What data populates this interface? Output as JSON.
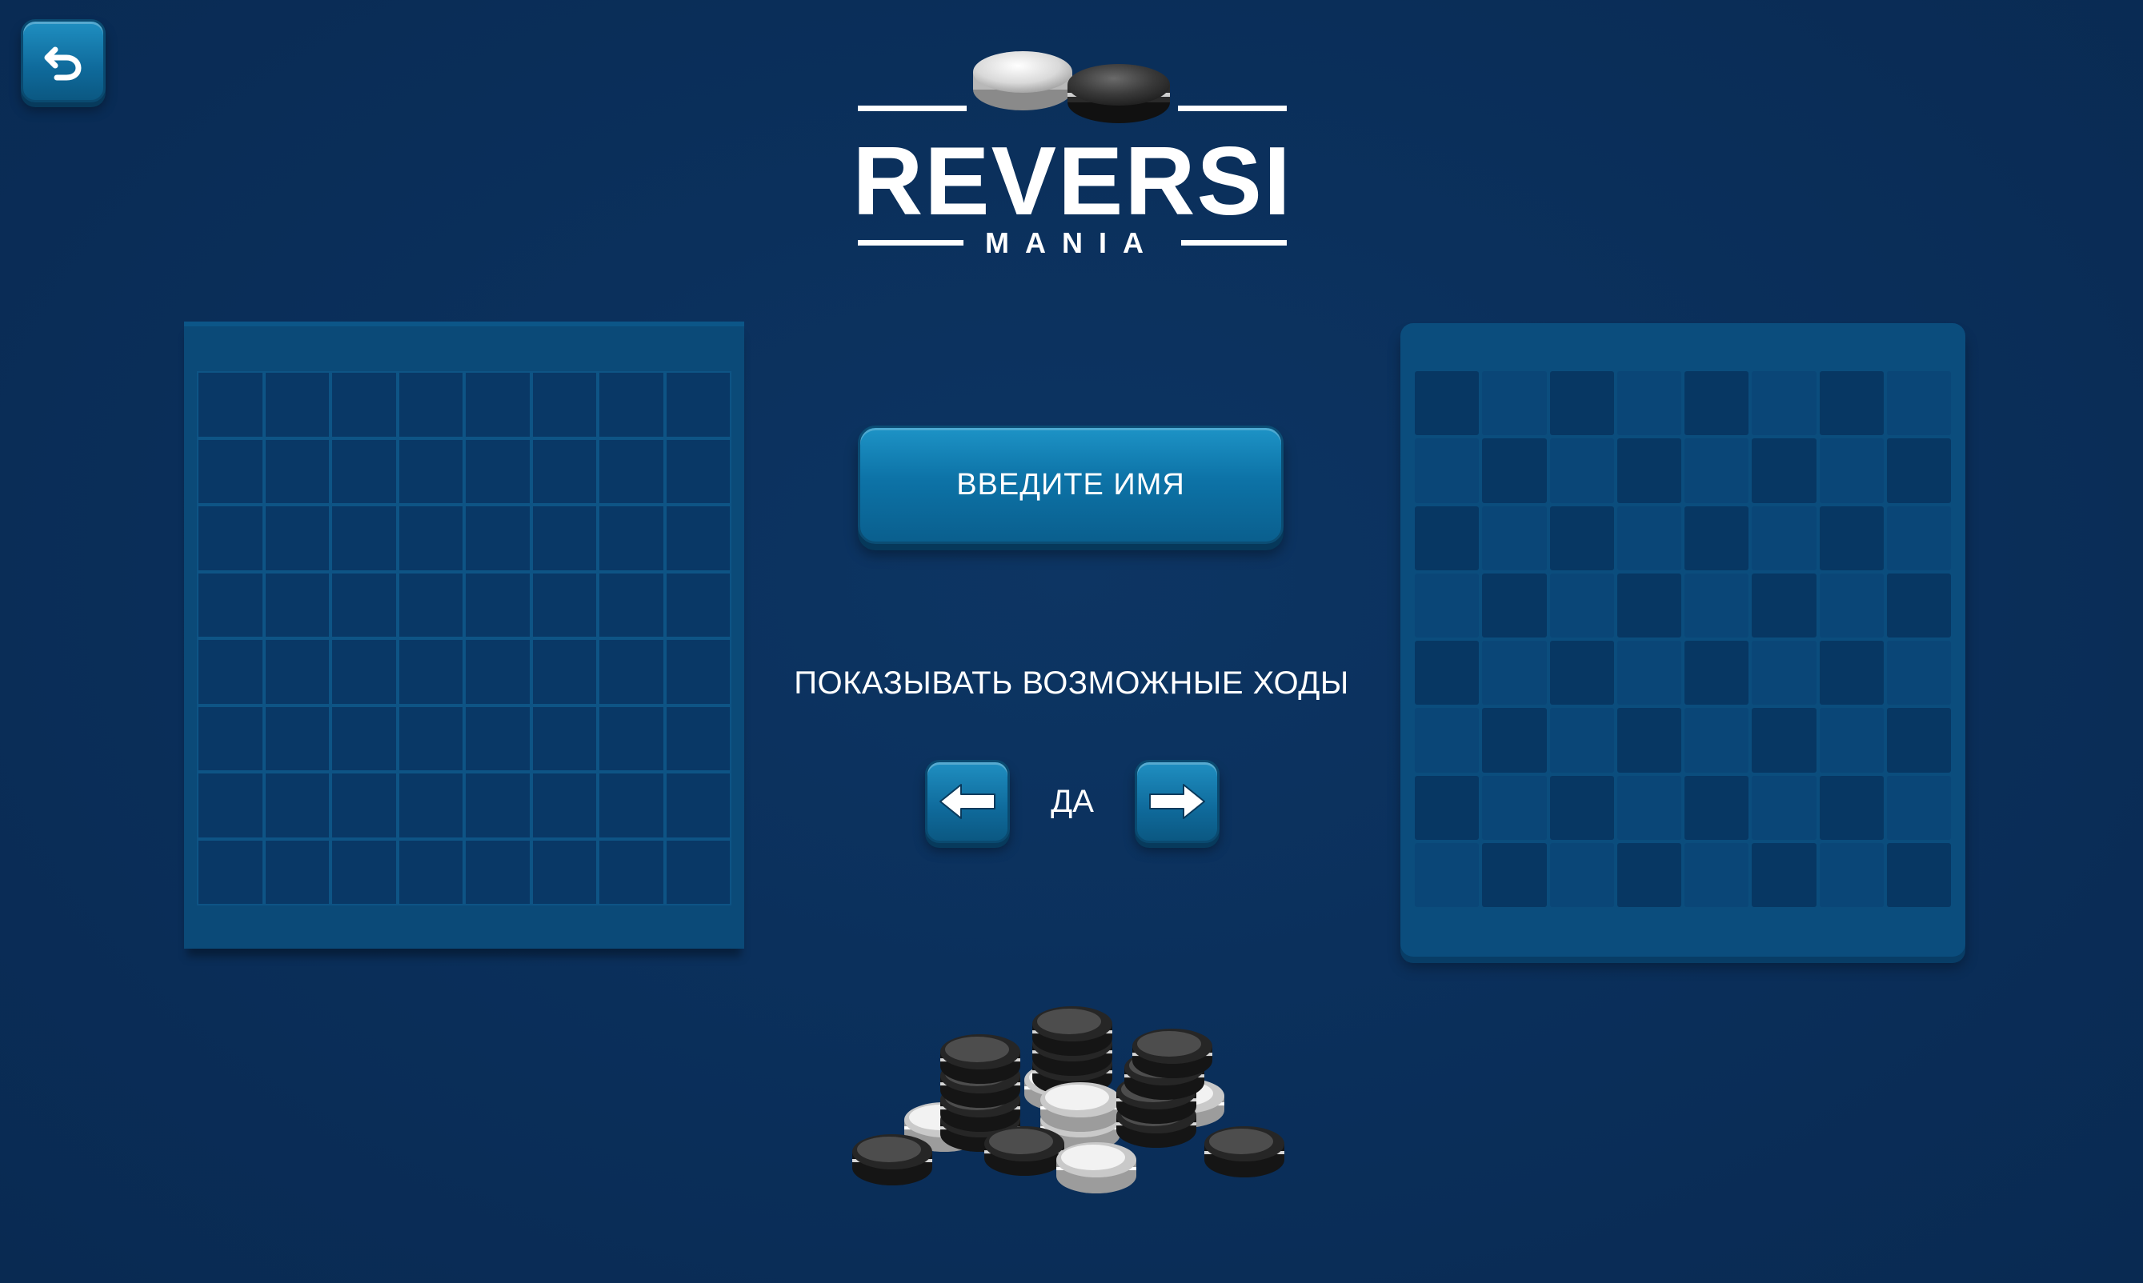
{
  "app": {
    "logo_title": "REVERSI",
    "logo_subtitle": "MANIA"
  },
  "toolbar": {
    "back_icon": "undo-arrow-icon"
  },
  "menu": {
    "name_button_label": "ВВЕДИТЕ ИМЯ",
    "show_moves_label": "ПОКАЗЫВАТЬ ВОЗМОЖНЫЕ ХОДЫ",
    "show_moves_value": "ДА",
    "prev_icon": "arrow-left-icon",
    "next_icon": "arrow-right-icon"
  },
  "boards": {
    "left_theme": "classic-grid",
    "right_theme": "checkered",
    "size": 8
  },
  "colors": {
    "background": "#0b2f5a",
    "button": "#0d73a7",
    "text": "#ffffff"
  }
}
